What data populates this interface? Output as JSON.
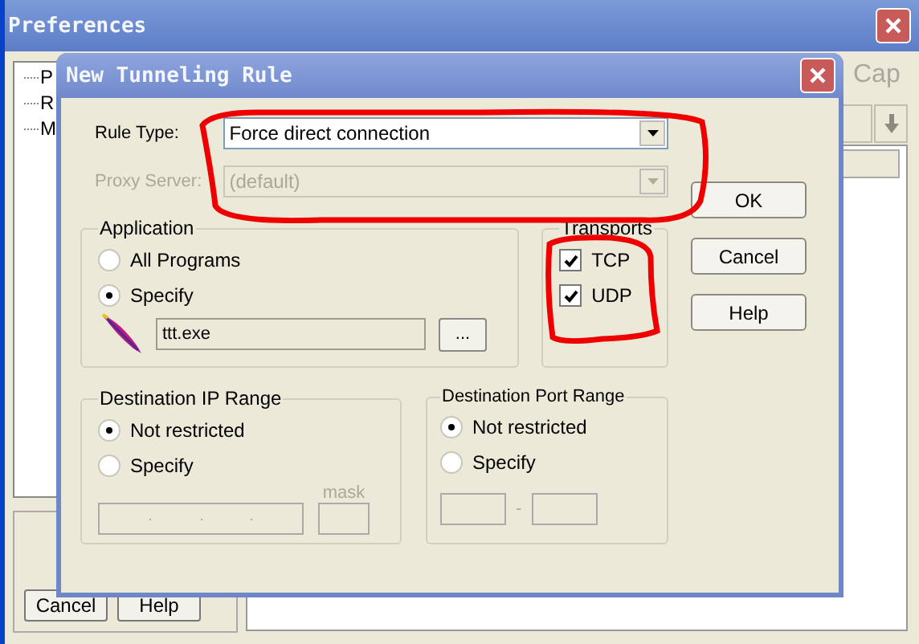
{
  "preferences_window": {
    "title": "Preferences",
    "tree_items": [
      "P",
      "R",
      "M"
    ],
    "partial_label": "Cap",
    "buttons": [
      "Cancel",
      "Help"
    ]
  },
  "dialog": {
    "title": "New Tunneling Rule",
    "rule_type": {
      "label": "Rule Type:",
      "value": "Force direct connection",
      "disabled": false
    },
    "proxy_server": {
      "label": "Proxy Server:",
      "value": "(default)",
      "disabled": true
    },
    "buttons": [
      "OK",
      "Cancel",
      "Help"
    ],
    "application": {
      "title": "Application",
      "options": [
        {
          "label": "All Programs",
          "selected": false
        },
        {
          "label": "Specify",
          "selected": true
        }
      ],
      "path": "ttt.exe",
      "browse_button": "..."
    },
    "transports": {
      "title": "Transports",
      "items": [
        {
          "label": "TCP",
          "checked": true
        },
        {
          "label": "UDP",
          "checked": true
        }
      ]
    },
    "ip_range": {
      "title": "Destination IP Range",
      "options": [
        {
          "label": "Not restricted",
          "selected": true
        },
        {
          "label": "Specify",
          "selected": false
        }
      ],
      "mask_label": "mask"
    },
    "port_range": {
      "title": "Destination Port Range",
      "options": [
        {
          "label": "Not restricted",
          "selected": true
        },
        {
          "label": "Specify",
          "selected": false
        }
      ],
      "separator": "-"
    }
  }
}
